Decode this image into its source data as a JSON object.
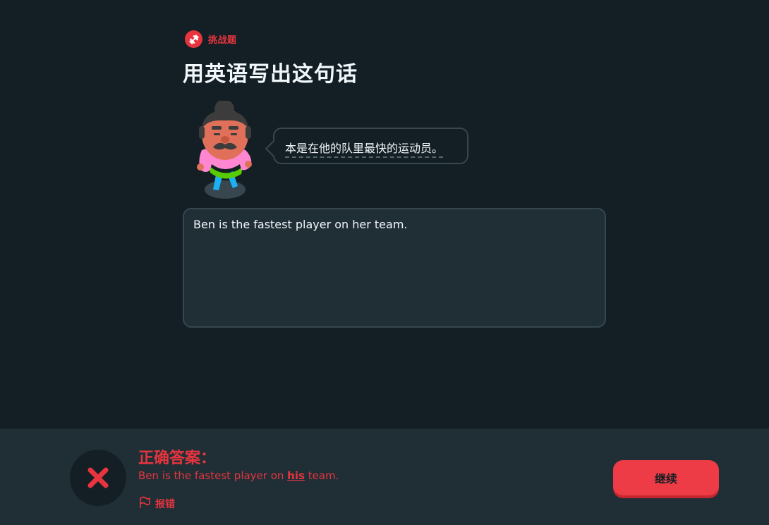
{
  "header": {
    "challenge_tag": "挑战题",
    "title": "用英语写出这句话"
  },
  "prompt": {
    "sentence": "本是在他的队里最快的运动员。"
  },
  "answer": {
    "value": "Ben is the fastest player on her team."
  },
  "feedback": {
    "heading": "正确答案：",
    "answer_before": "Ben is the fastest player on ",
    "answer_highlight": "his",
    "answer_after": " team.",
    "report_label": "报错",
    "continue_label": "继续"
  },
  "colors": {
    "background": "#131f24",
    "panel": "#202f36",
    "error_red": "#e8343e",
    "border": "#37464f"
  },
  "icons": {
    "challenge": "dumbbell-icon",
    "result": "close-x-icon",
    "report": "flag-icon"
  }
}
